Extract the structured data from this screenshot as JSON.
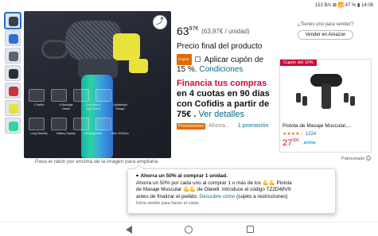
{
  "status_bar": {
    "right_text": "153 B/s ⊠ 📶 47 % ▮ 14:08"
  },
  "colors": {
    "accent_red": "#cc0c39",
    "link": "#007185",
    "badge_orange": "#e36b00",
    "star": "#de7921"
  },
  "thumbnails": [
    {
      "color": "#3a3f49"
    },
    {
      "color": "#2f6fd0"
    },
    {
      "color": "#5a6370"
    },
    {
      "color": "#27303a"
    },
    {
      "color": "#c8323a"
    },
    {
      "color": "#e9e23a"
    },
    {
      "color": "#2ed4a3"
    }
  ],
  "main_image": {
    "feature_labels": [
      "1 Switch",
      "4 Massage Heads",
      "Low Noise & High Speed",
      "Lightweight Design",
      "Long Standby",
      "Battery Display",
      "Rechargeable",
      "Max 3200rpm"
    ],
    "share_icon": "share-icon",
    "caption": "Pasa el ratón por encima de la imagen para ampliarla"
  },
  "price": {
    "whole": "63",
    "fraction": "97",
    "currency": "€",
    "unit_price": "(63,97€ / unidad)",
    "final_label": "Precio final del producto",
    "coupon_badge": "Cupón:",
    "coupon_text": "Aplicar cupón de 15 %.",
    "coupon_link": "Condiciones",
    "finance_red": "Financia tus compras",
    "finance_rest": "en 4 cuotas en 90 días con Cofidis a partir de 75€ .",
    "finance_link": "Ver detalles",
    "promo_badge": "Promociones",
    "promo_text": "Ahorra...",
    "promo_count": "1 promoción"
  },
  "sell": {
    "question": "¿Tienes uno para vender?",
    "button": "Vender en Amazon"
  },
  "ad": {
    "tag": "Cupón del 10%",
    "title": "Pistola de Masaje Muscular,...",
    "stars": "★★★★☆",
    "rating_count": "1224",
    "price_whole": "27",
    "price_fraction": "99",
    "price_currency": "€",
    "prime": "prime",
    "sponsored": "Patrocinado"
  },
  "popover": {
    "title": "Ahorra un 50% al comprar 1 unidad.",
    "line1": "Ahorra un 50% por cada uno al comprar 1 o más de los 💪💪 Pistola",
    "line2": "de Masaje Muscular 💪💪 de Olawill. Introduce el código TZ2D48V9",
    "line3_pre": "antes de finalizar el pedido.",
    "line3_link": "Descubre cómo",
    "line3_post": "(sujeto a restricciones)",
    "note": "Inicia sesión para hacer el canje."
  }
}
